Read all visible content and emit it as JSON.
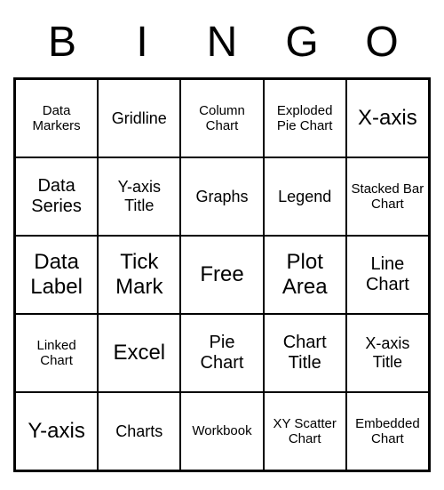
{
  "header": {
    "letters": [
      "B",
      "I",
      "N",
      "G",
      "O"
    ]
  },
  "grid": {
    "cells": [
      {
        "text": "Data Markers",
        "size": "small"
      },
      {
        "text": "Gridline",
        "size": ""
      },
      {
        "text": "Column Chart",
        "size": "small"
      },
      {
        "text": "Exploded Pie Chart",
        "size": "small"
      },
      {
        "text": "X-axis",
        "size": "large"
      },
      {
        "text": "Data Series",
        "size": "medium"
      },
      {
        "text": "Y-axis Title",
        "size": ""
      },
      {
        "text": "Graphs",
        "size": ""
      },
      {
        "text": "Legend",
        "size": ""
      },
      {
        "text": "Stacked Bar Chart",
        "size": "small"
      },
      {
        "text": "Data Label",
        "size": "large"
      },
      {
        "text": "Tick Mark",
        "size": "large"
      },
      {
        "text": "Free",
        "size": "large"
      },
      {
        "text": "Plot Area",
        "size": "large"
      },
      {
        "text": "Line Chart",
        "size": "medium"
      },
      {
        "text": "Linked Chart",
        "size": "small"
      },
      {
        "text": "Excel",
        "size": "large"
      },
      {
        "text": "Pie Chart",
        "size": "medium"
      },
      {
        "text": "Chart Title",
        "size": "medium"
      },
      {
        "text": "X-axis Title",
        "size": ""
      },
      {
        "text": "Y-axis",
        "size": "large"
      },
      {
        "text": "Charts",
        "size": ""
      },
      {
        "text": "Workbook",
        "size": "small"
      },
      {
        "text": "XY Scatter Chart",
        "size": "small"
      },
      {
        "text": "Embedded Chart",
        "size": "small"
      }
    ]
  }
}
